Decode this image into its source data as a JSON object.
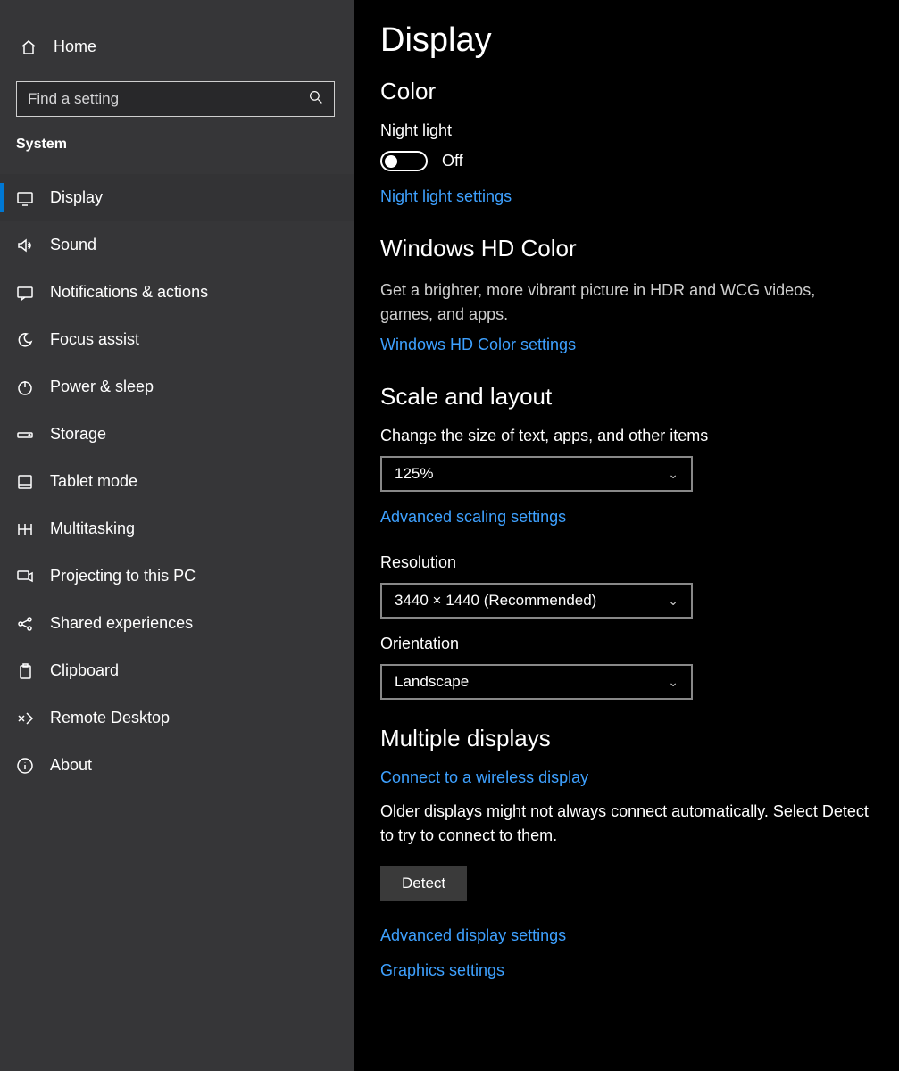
{
  "sidebar": {
    "home": "Home",
    "search_placeholder": "Find a setting",
    "section": "System",
    "items": [
      {
        "label": "Display"
      },
      {
        "label": "Sound"
      },
      {
        "label": "Notifications & actions"
      },
      {
        "label": "Focus assist"
      },
      {
        "label": "Power & sleep"
      },
      {
        "label": "Storage"
      },
      {
        "label": "Tablet mode"
      },
      {
        "label": "Multitasking"
      },
      {
        "label": "Projecting to this PC"
      },
      {
        "label": "Shared experiences"
      },
      {
        "label": "Clipboard"
      },
      {
        "label": "Remote Desktop"
      },
      {
        "label": "About"
      }
    ]
  },
  "main": {
    "title": "Display",
    "color": {
      "heading": "Color",
      "night_light_label": "Night light",
      "night_light_state": "Off",
      "night_light_link": "Night light settings"
    },
    "hd": {
      "heading": "Windows HD Color",
      "desc": "Get a brighter, more vibrant picture in HDR and WCG videos, games, and apps.",
      "link": "Windows HD Color settings"
    },
    "scale": {
      "heading": "Scale and layout",
      "size_label": "Change the size of text, apps, and other items",
      "size_value": "125%",
      "adv_scaling": "Advanced scaling settings",
      "res_label": "Resolution",
      "res_value": "3440 × 1440 (Recommended)",
      "orient_label": "Orientation",
      "orient_value": "Landscape"
    },
    "multi": {
      "heading": "Multiple displays",
      "connect": "Connect to a wireless display",
      "older": "Older displays might not always connect automatically. Select Detect to try to connect to them.",
      "detect": "Detect",
      "adv_display": "Advanced display settings",
      "graphics": "Graphics settings"
    }
  }
}
